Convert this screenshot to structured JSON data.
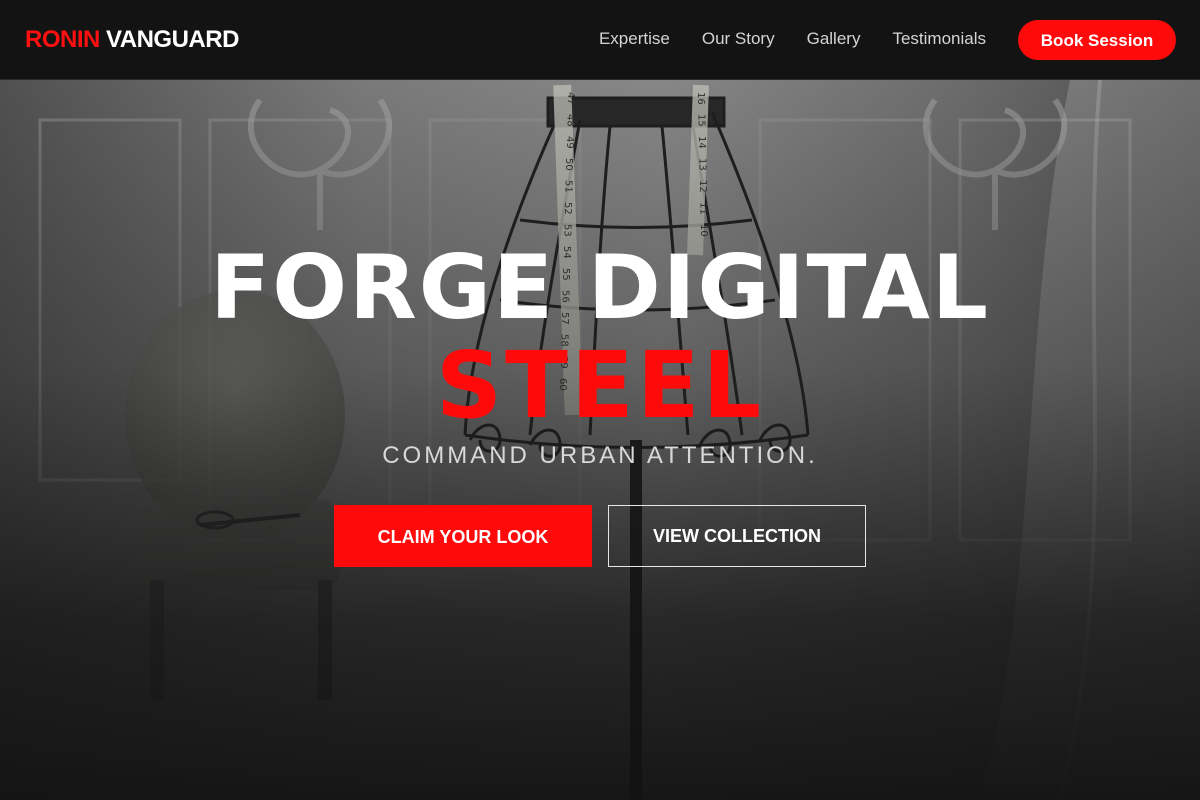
{
  "brand": {
    "logo_accent": "RONIN",
    "logo_main": "VANGUARD",
    "accent_color": "#ff0a0a"
  },
  "nav": {
    "items": [
      {
        "label": "Expertise"
      },
      {
        "label": "Our Story"
      },
      {
        "label": "Gallery"
      },
      {
        "label": "Testimonials"
      }
    ],
    "cta_label": "Book Session"
  },
  "hero": {
    "headline_line1": "FORGE DIGITAL",
    "headline_line2": "STEEL",
    "tagline": "COMMAND URBAN ATTENTION.",
    "primary_cta": "CLAIM YOUR LOOK",
    "secondary_cta": "VIEW COLLECTION",
    "background_icon": "dress-form-mannequin-image",
    "tape_numbers": [
      "47",
      "48",
      "49",
      "50",
      "51",
      "52",
      "53",
      "54",
      "55",
      "56",
      "57",
      "58",
      "59",
      "60"
    ],
    "tape_numbers_right": [
      "16",
      "15",
      "14",
      "13",
      "12",
      "11",
      "10"
    ]
  }
}
